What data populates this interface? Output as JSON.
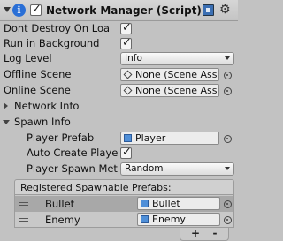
{
  "header": {
    "title": "Network Manager (Script)",
    "enabled": true
  },
  "fields": {
    "dont_destroy_label": "Dont Destroy On Loa",
    "run_background_label": "Run in Background",
    "log_level_label": "Log Level",
    "log_level_value": "Info",
    "offline_scene_label": "Offline Scene",
    "offline_scene_value": "None (Scene Ass",
    "online_scene_label": "Online Scene",
    "online_scene_value": "None (Scene Ass",
    "network_info_label": "Network Info",
    "spawn_info_label": "Spawn Info",
    "player_prefab_label": "Player Prefab",
    "player_prefab_value": "Player",
    "auto_create_label": "Auto Create Playe",
    "spawn_method_label": "Player Spawn Met",
    "spawn_method_value": "Random"
  },
  "prefab_list": {
    "header": "Registered Spawnable Prefabs:",
    "items": [
      {
        "label": "Bullet",
        "value": "Bullet"
      },
      {
        "label": "Enemy",
        "value": "Enemy"
      }
    ],
    "add_label": "+",
    "remove_label": "-"
  }
}
